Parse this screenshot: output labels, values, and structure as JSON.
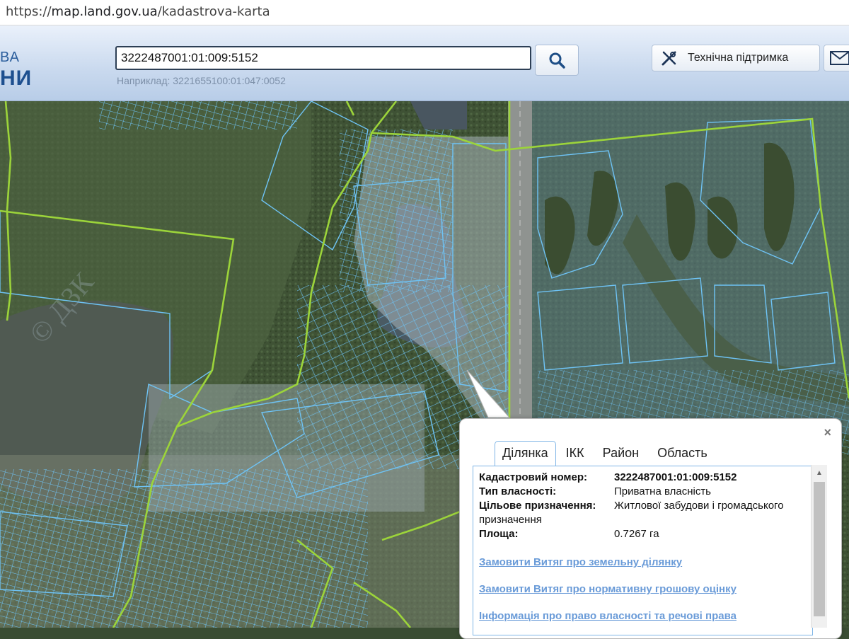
{
  "browser": {
    "url_scheme": "https://",
    "url_host": "map.land.gov.ua",
    "url_path": "/kadastrova-karta"
  },
  "header": {
    "logo_line1": "ВА",
    "logo_line2": "НИ",
    "search_value": "3222487001:01:009:5152",
    "search_hint": "Наприклад: 3221655100:01:047:0052",
    "support_label": "Технічна підтримка"
  },
  "popup": {
    "close_symbol": "×",
    "tabs": [
      "Ділянка",
      "ІКК",
      "Район",
      "Область"
    ],
    "active_tab": "Ділянка",
    "fields": [
      {
        "label": "Кадастровий номер:",
        "value": "3222487001:01:009:5152"
      },
      {
        "label": "Тип власності:",
        "value": "Приватна власність"
      },
      {
        "label": "Цільове призначення:",
        "value": "Житлової забудови і громадського",
        "value_cont": "призначення"
      },
      {
        "label": "Площа:",
        "value": "0.7267 га"
      }
    ],
    "links": [
      "Замовити Витяг про земельну ділянку",
      "Замовити Витяг про нормативну грошову оцінку",
      "Інформація про право власності та речові права"
    ]
  },
  "colors": {
    "parcel_stroke": "#6ec3f5",
    "boundary_stroke": "#9cd43a",
    "header_accent": "#1d4f8f",
    "link": "#6a9bd8"
  }
}
